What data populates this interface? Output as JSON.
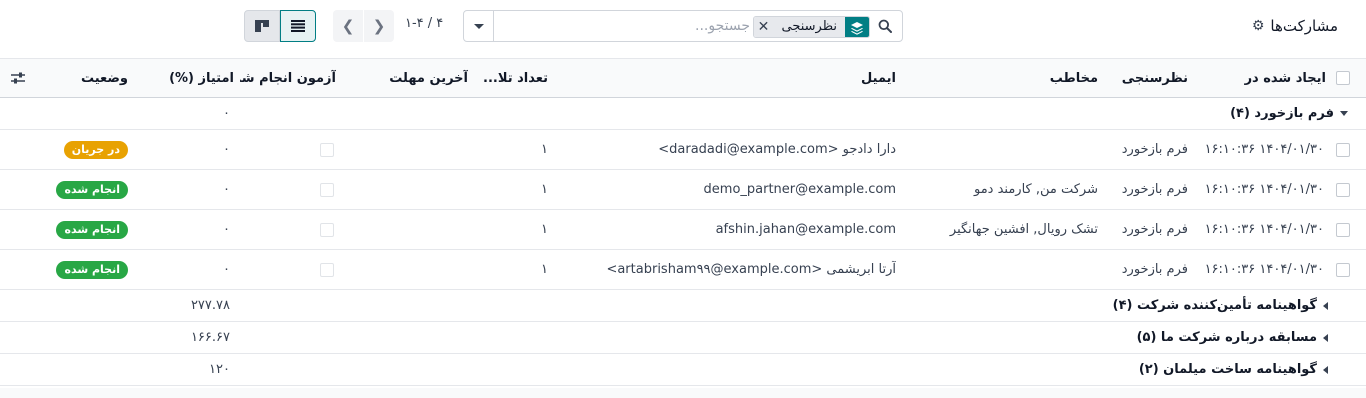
{
  "header": {
    "title": "مشارکت‌ها",
    "search_placeholder": "جستجو...",
    "facet_value": "نظرسنجی",
    "pager_text": "۱-۴ / ۴"
  },
  "columns": {
    "created_on": "ایجاد شده در",
    "survey": "نظرسنجی",
    "contact": "مخاطب",
    "email": "ایمیل",
    "attempts": "تعداد تلا...",
    "deadline": "آخرین مهلت",
    "certified": "آزمون انجام شد",
    "score": "امتیاز (%)",
    "status": "وضعیت"
  },
  "groups": [
    {
      "label": "فرم بازخورد (۴)",
      "score": "۰",
      "expanded": true
    },
    {
      "label": "گواهینامه تأمین‌کننده شرکت (۴)",
      "score": "۲۷۷.۷۸",
      "expanded": false
    },
    {
      "label": "مسابقه درباره شرکت ما (۵)",
      "score": "۱۶۶.۶۷",
      "expanded": false
    },
    {
      "label": "گواهینامه ساخت میلمان (۲)",
      "score": "۱۲۰",
      "expanded": false
    }
  ],
  "rows": [
    {
      "created_on": "۱۴۰۴/۰۱/۳۰ ۱۶:۱۰:۳۶",
      "survey": "فرم بازخورد",
      "contact": "",
      "email": "دارا دادجو <daradadi@example.com>",
      "attempts": "۱",
      "score": "۰",
      "status": "در جریان"
    },
    {
      "created_on": "۱۴۰۴/۰۱/۳۰ ۱۶:۱۰:۳۶",
      "survey": "فرم بازخورد",
      "contact": "شرکت من, کارمند دمو",
      "email": "demo_partner@example.com",
      "attempts": "۱",
      "score": "۰",
      "status": "انجام شده"
    },
    {
      "created_on": "۱۴۰۴/۰۱/۳۰ ۱۶:۱۰:۳۶",
      "survey": "فرم بازخورد",
      "contact": "تشک رویال, افشین جهانگیر",
      "email": "afshin.jahan@example.com",
      "attempts": "۱",
      "score": "۰",
      "status": "انجام شده"
    },
    {
      "created_on": "۱۴۰۴/۰۱/۳۰ ۱۶:۱۰:۳۶",
      "survey": "فرم بازخورد",
      "contact": "",
      "email": "آرتا ابریشمی <artabrisham۹۹@example.com>",
      "attempts": "۱",
      "score": "۰",
      "status": "انجام شده"
    }
  ],
  "colors": {
    "accent": "#017e84",
    "in_progress": "#e8a202",
    "done": "#28a745"
  },
  "icons": [
    "gear-icon",
    "search-icon",
    "filter-layers-icon",
    "close-icon",
    "caret-down-icon",
    "chevron-left-icon",
    "chevron-right-icon",
    "kanban-view-icon",
    "list-view-icon",
    "optional-columns-icon"
  ]
}
